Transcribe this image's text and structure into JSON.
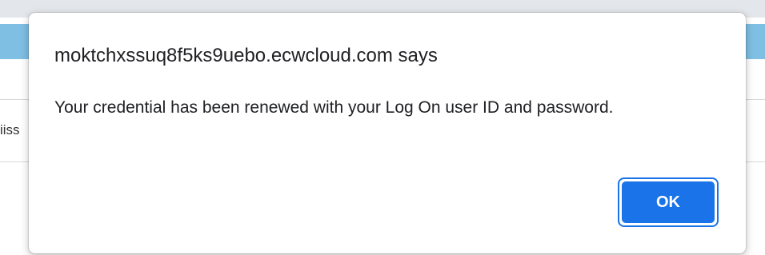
{
  "background": {
    "fragment_text": "iiss"
  },
  "dialog": {
    "title": "moktchxssuq8f5ks9uebo.ecwcloud.com says",
    "message": "Your credential has been renewed with your Log On user ID and password.",
    "ok_label": "OK"
  },
  "colors": {
    "accent": "#1a73e8",
    "background_band": "#7fbfe3"
  }
}
